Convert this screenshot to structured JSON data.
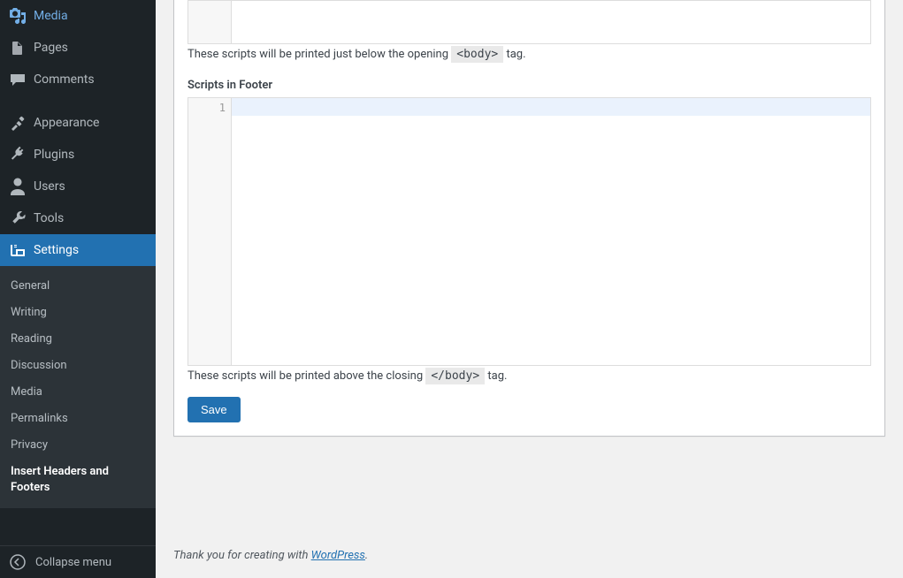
{
  "sidebar": {
    "items": [
      {
        "label": "Media"
      },
      {
        "label": "Pages"
      },
      {
        "label": "Comments"
      },
      {
        "label": "Appearance"
      },
      {
        "label": "Plugins"
      },
      {
        "label": "Users"
      },
      {
        "label": "Tools"
      },
      {
        "label": "Settings"
      }
    ],
    "submenu": [
      {
        "label": "General"
      },
      {
        "label": "Writing"
      },
      {
        "label": "Reading"
      },
      {
        "label": "Discussion"
      },
      {
        "label": "Media"
      },
      {
        "label": "Permalinks"
      },
      {
        "label": "Privacy"
      },
      {
        "label": "Insert Headers and Footers"
      }
    ],
    "collapse": "Collapse menu"
  },
  "main": {
    "body_hint_pre": "These scripts will be printed just below the opening ",
    "body_hint_code": "<body>",
    "body_hint_post": " tag.",
    "footer_label": "Scripts in Footer",
    "line_number": "1",
    "footer_hint_pre": "These scripts will be printed above the closing ",
    "footer_hint_code": "</body>",
    "footer_hint_post": " tag.",
    "save": "Save"
  },
  "footer": {
    "text_pre": "Thank you for creating with ",
    "link": "WordPress",
    "text_post": "."
  }
}
